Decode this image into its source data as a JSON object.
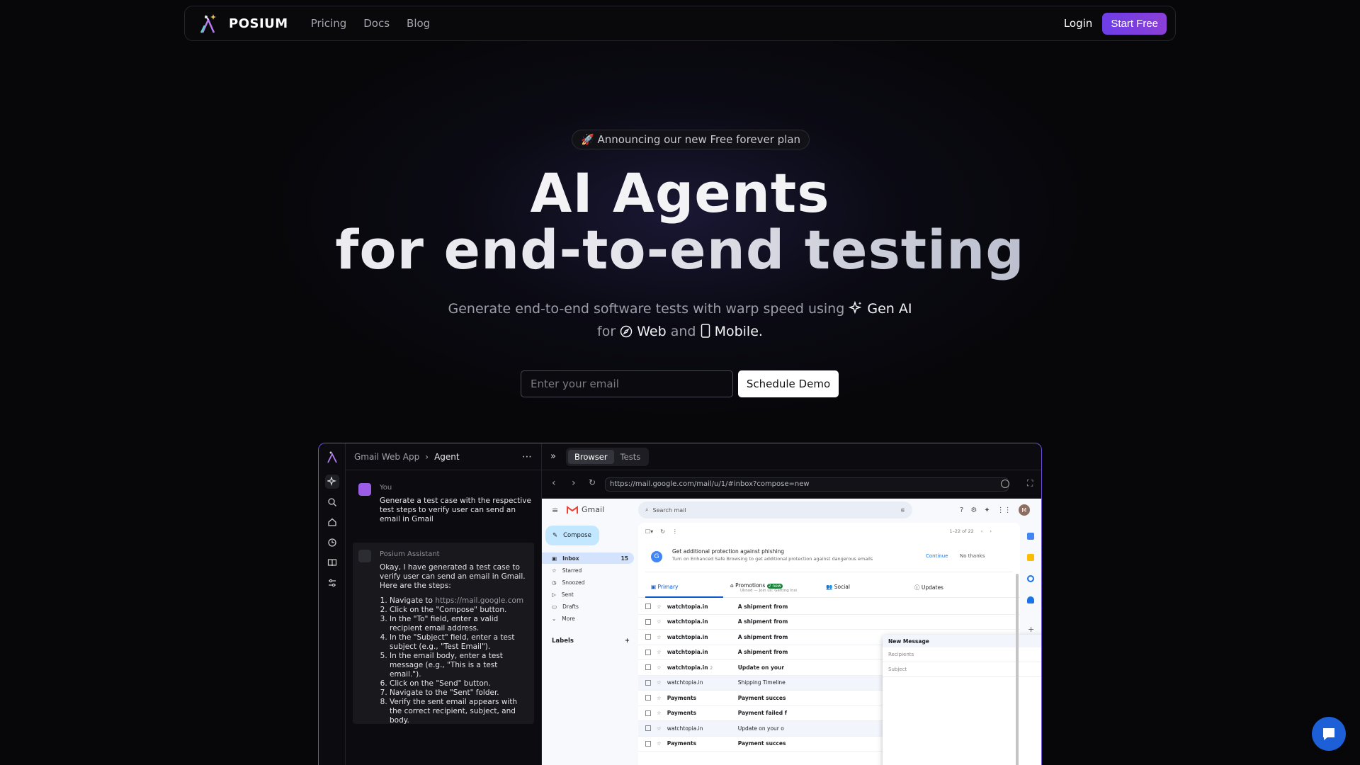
{
  "nav": {
    "brand": "POSIUM",
    "links": [
      "Pricing",
      "Docs",
      "Blog"
    ],
    "login": "Login",
    "start_free": "Start Free"
  },
  "hero": {
    "announcement": "🚀 Announcing our new Free forever plan",
    "title_line1": "AI Agents",
    "title_line2": "for end-to-end testing",
    "subtitle_part1": "Generate end-to-end software tests with warp speed using",
    "subtitle_genai": "Gen AI",
    "subtitle_for": "for",
    "subtitle_web": "Web",
    "subtitle_and": "and",
    "subtitle_mobile": "Mobile.",
    "email_placeholder": "Enter your email",
    "demo_button": "Schedule Demo"
  },
  "app": {
    "breadcrumb_project": "Gmail Web App",
    "breadcrumb_page": "Agent",
    "tabs": [
      "Browser",
      "Tests"
    ],
    "url": "https://mail.google.com/mail/u/1/#inbox?compose=new",
    "user_label": "You",
    "user_message": "Generate a test case with the respective test steps to verify user can send an email in Gmail",
    "assistant_label": "Posium Assistant",
    "assistant_intro": "Okay, I have generated a test case to verify user can send an email in Gmail. Here are the steps:",
    "steps": [
      "Navigate to",
      "Click on the \"Compose\" button.",
      "In the \"To\" field, enter a valid recipient email address.",
      "In the \"Subject\" field, enter a test subject (e.g., \"Test Email\").",
      "In the email body, enter a test message (e.g., \"This is a test email.\").",
      "Click on the \"Send\" button.",
      "Navigate to the \"Sent\" folder.",
      "Verify the sent email appears with the correct recipient, subject, and body."
    ],
    "step1_link": "https://mail.google.com"
  },
  "gmail": {
    "brand": "Gmail",
    "search_placeholder": "Search mail",
    "compose": "Compose",
    "nav": [
      {
        "label": "Inbox",
        "count": "15"
      },
      {
        "label": "Starred",
        "count": ""
      },
      {
        "label": "Snoozed",
        "count": ""
      },
      {
        "label": "Sent",
        "count": ""
      },
      {
        "label": "Drafts",
        "count": ""
      },
      {
        "label": "More",
        "count": ""
      }
    ],
    "labels_heading": "Labels",
    "pager": "1–22 of 22",
    "banner_title": "Get additional protection against phishing",
    "banner_sub": "Turn on Enhanced Safe Browsing to get additional protection against dangerous emails",
    "banner_continue": "Continue",
    "banner_dismiss": "No thanks",
    "tabs": [
      "Primary",
      "Promotions",
      "Social",
      "Updates"
    ],
    "promo_badge": "2 new",
    "promo_sub": "Uknod — Join us: Getting Insi...",
    "rows": [
      {
        "sender": "watchtopia.in",
        "subject": "A shipment from",
        "read": false,
        "count": ""
      },
      {
        "sender": "watchtopia.in",
        "subject": "A shipment from",
        "read": false,
        "count": ""
      },
      {
        "sender": "watchtopia.in",
        "subject": "A shipment from",
        "read": false,
        "count": ""
      },
      {
        "sender": "watchtopia.in",
        "subject": "A shipment from",
        "read": false,
        "count": ""
      },
      {
        "sender": "watchtopia.in",
        "subject": "Update on your",
        "read": false,
        "count": "2"
      },
      {
        "sender": "watchtopia.in",
        "subject": "Shipping Timeline",
        "read": true,
        "count": ""
      },
      {
        "sender": "Payments",
        "subject": "Payment succes",
        "read": false,
        "count": ""
      },
      {
        "sender": "Payments",
        "subject": "Payment failed f",
        "read": false,
        "count": ""
      },
      {
        "sender": "watchtopia.in",
        "subject": "Update on your o",
        "read": true,
        "count": ""
      },
      {
        "sender": "Payments",
        "subject": "Payment succes",
        "read": false,
        "count": ""
      }
    ],
    "new_message_title": "New Message",
    "recipients_placeholder": "Recipients",
    "subject_placeholder": "Subject",
    "avatar_letter": "M"
  },
  "colors": {
    "accent": "#7c3aed",
    "app_border": "#6b4fd8",
    "fab": "#1c5fd6"
  }
}
